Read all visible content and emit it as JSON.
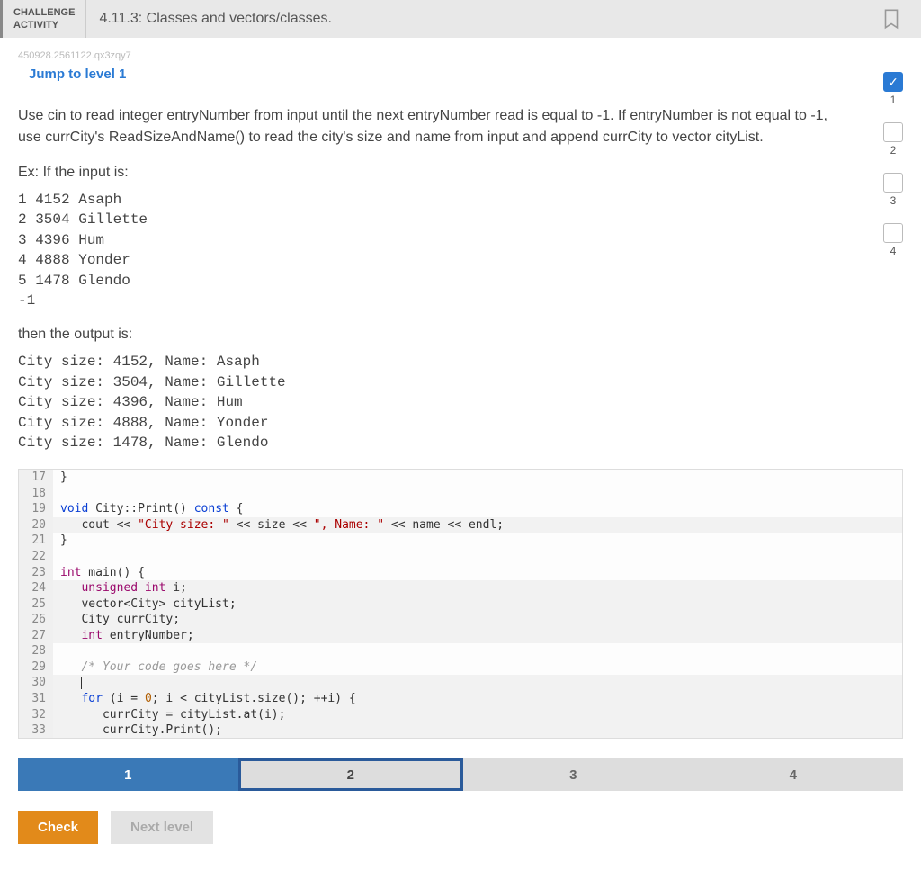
{
  "header": {
    "label_line1": "CHALLENGE",
    "label_line2": "ACTIVITY",
    "title": "4.11.3: Classes and vectors/classes."
  },
  "session_id": "450928.2561122.qx3zqy7",
  "jump_link": "Jump to level 1",
  "progress": [
    {
      "num": "1",
      "done": true
    },
    {
      "num": "2",
      "done": false
    },
    {
      "num": "3",
      "done": false
    },
    {
      "num": "4",
      "done": false
    }
  ],
  "instructions": "Use cin to read integer entryNumber from input until the next entryNumber read is equal to -1. If entryNumber is not equal to -1, use currCity's ReadSizeAndName() to read the city's size and name from input and append currCity to vector cityList.",
  "ex_label": "Ex: If the input is:",
  "input_sample": "1 4152 Asaph\n2 3504 Gillette\n3 4396 Hum\n4 4888 Yonder\n5 1478 Glendo\n-1",
  "output_label": "then the output is:",
  "output_sample": "City size: 4152, Name: Asaph\nCity size: 3504, Name: Gillette\nCity size: 4396, Name: Hum\nCity size: 4888, Name: Yonder\nCity size: 1478, Name: Glendo",
  "code_lines": {
    "17": "}",
    "18": "",
    "19_pre": "void",
    "19_mid": " City::Print() ",
    "19_const": "const",
    "19_end": " {",
    "20_pre": "   cout << ",
    "20_s1": "\"City size: \"",
    "20_mid1": " << size << ",
    "20_s2": "\", Name: \"",
    "20_end": " << name << endl;",
    "21": "}",
    "22": "",
    "23_ty": "int",
    "23_rest": " main() {",
    "24_pre": "   ",
    "24_ty": "unsigned int",
    "24_rest": " i;",
    "25_pre": "   vector<City> cityList;",
    "26_pre": "   City currCity;",
    "27_pre": "   ",
    "27_ty": "int",
    "27_rest": " entryNumber;",
    "28": "",
    "29_pre": "   ",
    "29_cm": "/* Your code goes here */",
    "30": "   ",
    "31_pre": "   ",
    "31_kw": "for",
    "31_rest": " (i = ",
    "31_nu": "0",
    "31_rest2": "; i < cityList.size(); ++i) {",
    "32": "      currCity = cityList.at(i);",
    "33": "      currCity.Print();",
    "34": "   }",
    "35": ""
  },
  "steps": {
    "s1": "1",
    "s2": "2",
    "s3": "3",
    "s4": "4"
  },
  "buttons": {
    "check": "Check",
    "next": "Next level"
  }
}
